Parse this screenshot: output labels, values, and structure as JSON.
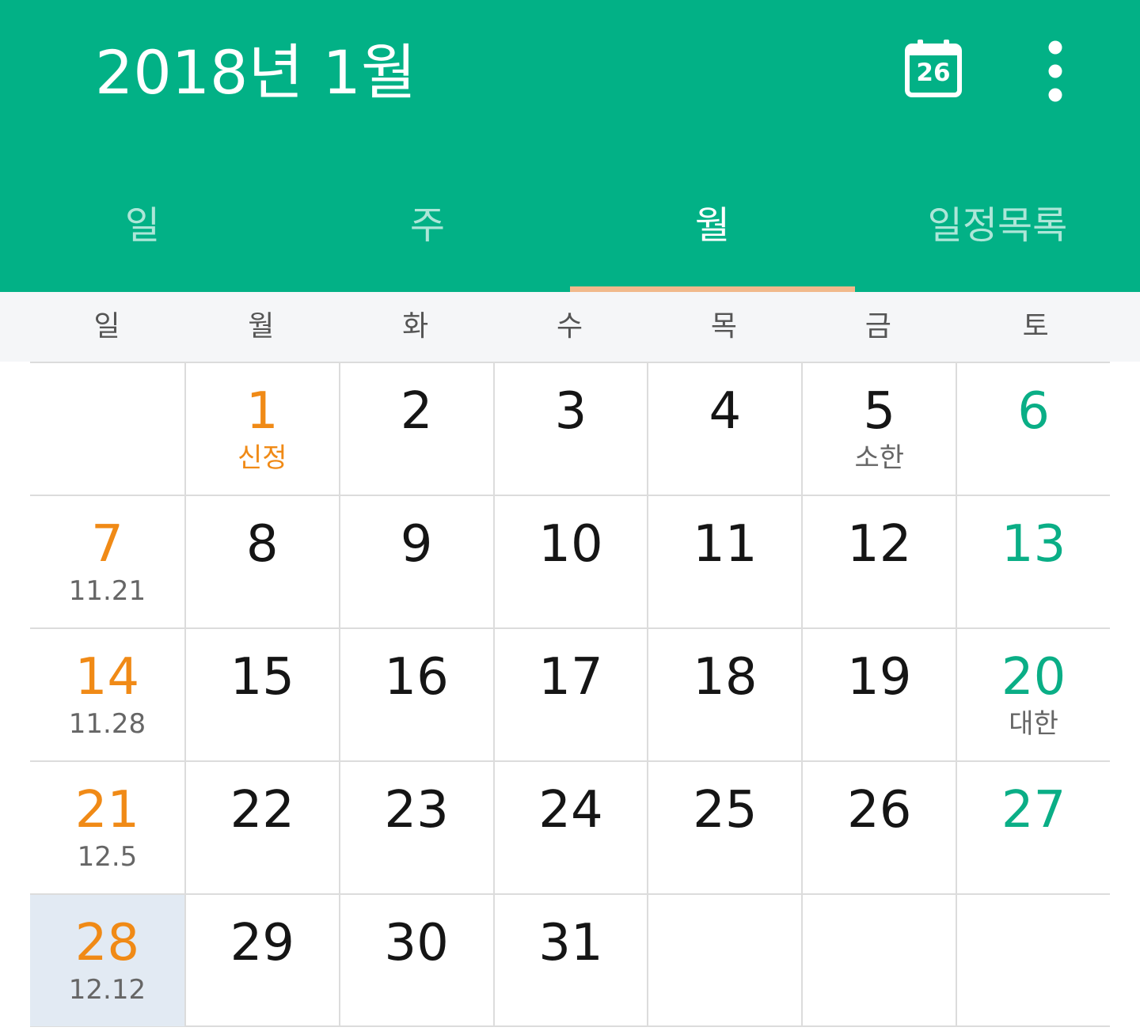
{
  "header": {
    "title": "2018년 1월",
    "today_icon_label": "26",
    "today_icon": "calendar-icon",
    "menu_icon": "more-vert-icon"
  },
  "tabs": [
    {
      "label": "일",
      "active": false
    },
    {
      "label": "주",
      "active": false
    },
    {
      "label": "월",
      "active": true
    },
    {
      "label": "일정목록",
      "active": false
    }
  ],
  "weekdays": [
    "일",
    "월",
    "화",
    "수",
    "목",
    "금",
    "토"
  ],
  "weeks": [
    [
      {
        "day": "",
        "sub": ""
      },
      {
        "day": "1",
        "sub": "신정",
        "holiday": true
      },
      {
        "day": "2",
        "sub": ""
      },
      {
        "day": "3",
        "sub": ""
      },
      {
        "day": "4",
        "sub": ""
      },
      {
        "day": "5",
        "sub": "소한"
      },
      {
        "day": "6",
        "sub": ""
      }
    ],
    [
      {
        "day": "7",
        "sub": "11.21"
      },
      {
        "day": "8",
        "sub": ""
      },
      {
        "day": "9",
        "sub": ""
      },
      {
        "day": "10",
        "sub": ""
      },
      {
        "day": "11",
        "sub": ""
      },
      {
        "day": "12",
        "sub": ""
      },
      {
        "day": "13",
        "sub": ""
      }
    ],
    [
      {
        "day": "14",
        "sub": "11.28"
      },
      {
        "day": "15",
        "sub": ""
      },
      {
        "day": "16",
        "sub": ""
      },
      {
        "day": "17",
        "sub": ""
      },
      {
        "day": "18",
        "sub": ""
      },
      {
        "day": "19",
        "sub": ""
      },
      {
        "day": "20",
        "sub": "대한"
      }
    ],
    [
      {
        "day": "21",
        "sub": "12.5"
      },
      {
        "day": "22",
        "sub": ""
      },
      {
        "day": "23",
        "sub": ""
      },
      {
        "day": "24",
        "sub": ""
      },
      {
        "day": "25",
        "sub": ""
      },
      {
        "day": "26",
        "sub": ""
      },
      {
        "day": "27",
        "sub": ""
      }
    ],
    [
      {
        "day": "28",
        "sub": "12.12",
        "selected": true
      },
      {
        "day": "29",
        "sub": ""
      },
      {
        "day": "30",
        "sub": ""
      },
      {
        "day": "31",
        "sub": ""
      },
      {
        "day": "",
        "sub": ""
      },
      {
        "day": "",
        "sub": ""
      },
      {
        "day": "",
        "sub": ""
      }
    ]
  ],
  "colors": {
    "primary": "#02b186",
    "sunday": "#f08a16",
    "saturday": "#0aae86",
    "tab_indicator": "#f1b98c",
    "selected_cell": "#e2eaf3",
    "weekday_bar": "#f5f6f8"
  }
}
